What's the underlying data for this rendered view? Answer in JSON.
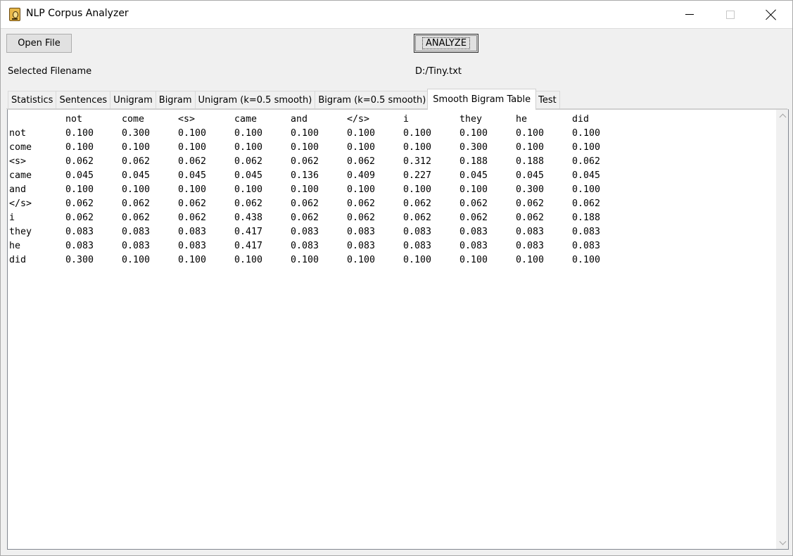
{
  "window": {
    "title": "NLP Corpus Analyzer"
  },
  "toolbar": {
    "open_label": "Open File",
    "analyze_label": "ANALYZE"
  },
  "file": {
    "selected_label": "Selected Filename",
    "path": "D:/Tiny.txt"
  },
  "tabs": [
    {
      "label": "Statistics"
    },
    {
      "label": "Sentences"
    },
    {
      "label": "Unigram"
    },
    {
      "label": "Bigram"
    },
    {
      "label": "Unigram (k=0.5 smooth)"
    },
    {
      "label": "Bigram (k=0.5 smooth)"
    },
    {
      "label": "Smooth Bigram Table",
      "active": true
    },
    {
      "label": "Test"
    }
  ],
  "table": {
    "header": [
      "",
      "not",
      "come",
      "<s>",
      "came",
      "and",
      "</s>",
      "i",
      "they",
      "he",
      "did"
    ],
    "rows": [
      [
        "not",
        "0.100",
        "0.300",
        "0.100",
        "0.100",
        "0.100",
        "0.100",
        "0.100",
        "0.100",
        "0.100",
        "0.100"
      ],
      [
        "come",
        "0.100",
        "0.100",
        "0.100",
        "0.100",
        "0.100",
        "0.100",
        "0.100",
        "0.300",
        "0.100",
        "0.100"
      ],
      [
        "<s>",
        "0.062",
        "0.062",
        "0.062",
        "0.062",
        "0.062",
        "0.062",
        "0.312",
        "0.188",
        "0.188",
        "0.062"
      ],
      [
        "came",
        "0.045",
        "0.045",
        "0.045",
        "0.045",
        "0.136",
        "0.409",
        "0.227",
        "0.045",
        "0.045",
        "0.045"
      ],
      [
        "and",
        "0.100",
        "0.100",
        "0.100",
        "0.100",
        "0.100",
        "0.100",
        "0.100",
        "0.100",
        "0.300",
        "0.100"
      ],
      [
        "</s>",
        "0.062",
        "0.062",
        "0.062",
        "0.062",
        "0.062",
        "0.062",
        "0.062",
        "0.062",
        "0.062",
        "0.062"
      ],
      [
        "i",
        "0.062",
        "0.062",
        "0.062",
        "0.438",
        "0.062",
        "0.062",
        "0.062",
        "0.062",
        "0.062",
        "0.188"
      ],
      [
        "they",
        "0.083",
        "0.083",
        "0.083",
        "0.417",
        "0.083",
        "0.083",
        "0.083",
        "0.083",
        "0.083",
        "0.083"
      ],
      [
        "he",
        "0.083",
        "0.083",
        "0.083",
        "0.417",
        "0.083",
        "0.083",
        "0.083",
        "0.083",
        "0.083",
        "0.083"
      ],
      [
        "did",
        "0.300",
        "0.100",
        "0.100",
        "0.100",
        "0.100",
        "0.100",
        "0.100",
        "0.100",
        "0.100",
        "0.100"
      ]
    ]
  }
}
